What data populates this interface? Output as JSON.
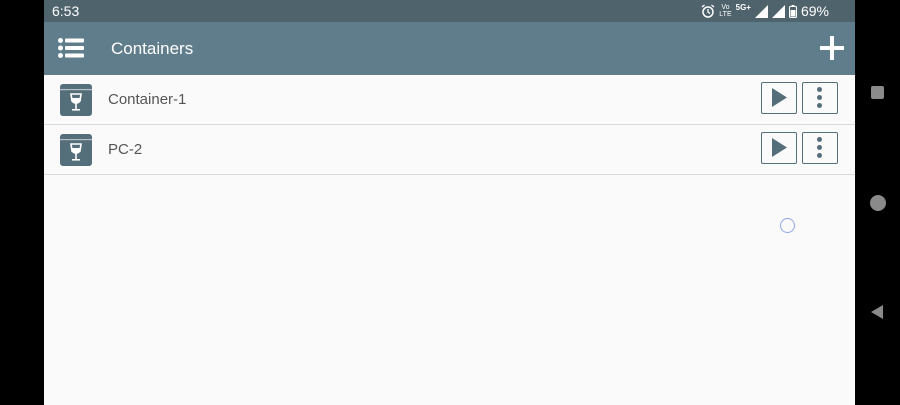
{
  "status": {
    "time": "6:53",
    "volte_line1": "Vo",
    "volte_line2": "LTE",
    "network": "5G+",
    "battery": "69%"
  },
  "appbar": {
    "title": "Containers"
  },
  "containers": [
    {
      "name": "Container-1"
    },
    {
      "name": "PC-2"
    }
  ],
  "colors": {
    "statusbar": "#4f636d",
    "appbar": "#607d8b",
    "icon": "#546e7a",
    "background": "#fafafa"
  }
}
